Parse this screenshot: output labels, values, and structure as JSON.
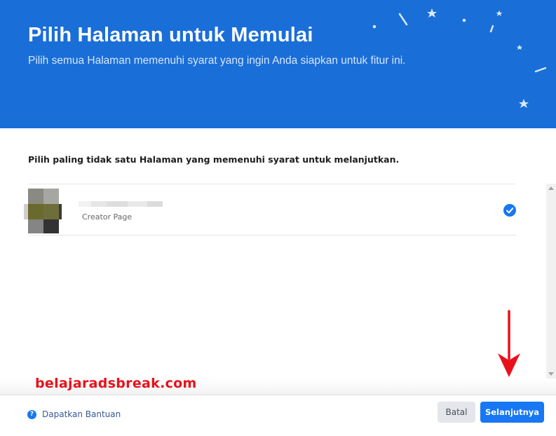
{
  "header": {
    "title": "Pilih Halaman untuk Memulai",
    "subtitle": "Pilih semua Halaman memenuhi syarat yang ingin Anda siapkan untuk fitur ini."
  },
  "main": {
    "instruction": "Pilih paling tidak satu Halaman yang memenuhi syarat untuk melanjutkan.",
    "pages": [
      {
        "type": "Creator Page",
        "selected": true
      }
    ]
  },
  "watermark": "belajaradsbreak.com",
  "footer": {
    "help_label": "Dapatkan Bantuan",
    "help_icon_glyph": "?",
    "cancel_label": "Batal",
    "next_label": "Selanjutnya"
  },
  "colors": {
    "header_bg": "#1a6ed8",
    "primary": "#1877f2",
    "watermark": "#e8111a",
    "annotation_arrow": "#e8111a"
  },
  "icons": {
    "help": "question-circle-icon",
    "check": "check-circle-icon",
    "annotation": "red-down-arrow-icon"
  }
}
